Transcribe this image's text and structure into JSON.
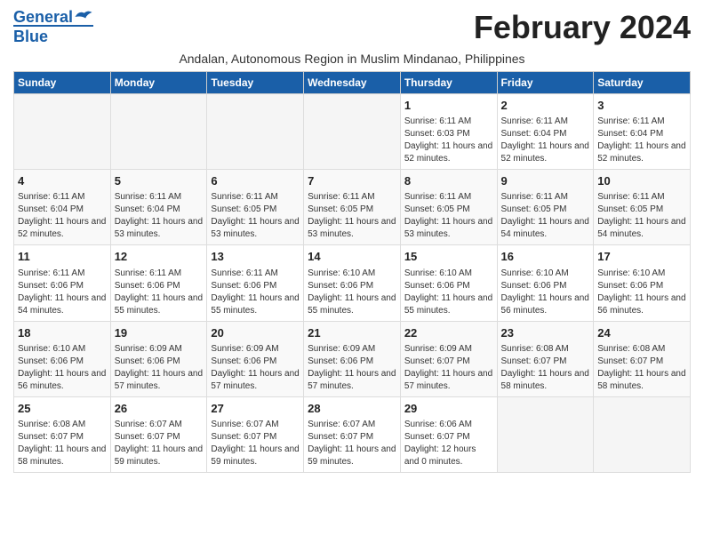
{
  "header": {
    "logo_line1": "General",
    "logo_line2": "Blue",
    "title": "February 2024",
    "subtitle": "Andalan, Autonomous Region in Muslim Mindanao, Philippines"
  },
  "weekdays": [
    "Sunday",
    "Monday",
    "Tuesday",
    "Wednesday",
    "Thursday",
    "Friday",
    "Saturday"
  ],
  "weeks": [
    [
      {
        "day": "",
        "info": ""
      },
      {
        "day": "",
        "info": ""
      },
      {
        "day": "",
        "info": ""
      },
      {
        "day": "",
        "info": ""
      },
      {
        "day": "1",
        "info": "Sunrise: 6:11 AM\nSunset: 6:03 PM\nDaylight: 11 hours and 52 minutes."
      },
      {
        "day": "2",
        "info": "Sunrise: 6:11 AM\nSunset: 6:04 PM\nDaylight: 11 hours and 52 minutes."
      },
      {
        "day": "3",
        "info": "Sunrise: 6:11 AM\nSunset: 6:04 PM\nDaylight: 11 hours and 52 minutes."
      }
    ],
    [
      {
        "day": "4",
        "info": "Sunrise: 6:11 AM\nSunset: 6:04 PM\nDaylight: 11 hours and 52 minutes."
      },
      {
        "day": "5",
        "info": "Sunrise: 6:11 AM\nSunset: 6:04 PM\nDaylight: 11 hours and 53 minutes."
      },
      {
        "day": "6",
        "info": "Sunrise: 6:11 AM\nSunset: 6:05 PM\nDaylight: 11 hours and 53 minutes."
      },
      {
        "day": "7",
        "info": "Sunrise: 6:11 AM\nSunset: 6:05 PM\nDaylight: 11 hours and 53 minutes."
      },
      {
        "day": "8",
        "info": "Sunrise: 6:11 AM\nSunset: 6:05 PM\nDaylight: 11 hours and 53 minutes."
      },
      {
        "day": "9",
        "info": "Sunrise: 6:11 AM\nSunset: 6:05 PM\nDaylight: 11 hours and 54 minutes."
      },
      {
        "day": "10",
        "info": "Sunrise: 6:11 AM\nSunset: 6:05 PM\nDaylight: 11 hours and 54 minutes."
      }
    ],
    [
      {
        "day": "11",
        "info": "Sunrise: 6:11 AM\nSunset: 6:06 PM\nDaylight: 11 hours and 54 minutes."
      },
      {
        "day": "12",
        "info": "Sunrise: 6:11 AM\nSunset: 6:06 PM\nDaylight: 11 hours and 55 minutes."
      },
      {
        "day": "13",
        "info": "Sunrise: 6:11 AM\nSunset: 6:06 PM\nDaylight: 11 hours and 55 minutes."
      },
      {
        "day": "14",
        "info": "Sunrise: 6:10 AM\nSunset: 6:06 PM\nDaylight: 11 hours and 55 minutes."
      },
      {
        "day": "15",
        "info": "Sunrise: 6:10 AM\nSunset: 6:06 PM\nDaylight: 11 hours and 55 minutes."
      },
      {
        "day": "16",
        "info": "Sunrise: 6:10 AM\nSunset: 6:06 PM\nDaylight: 11 hours and 56 minutes."
      },
      {
        "day": "17",
        "info": "Sunrise: 6:10 AM\nSunset: 6:06 PM\nDaylight: 11 hours and 56 minutes."
      }
    ],
    [
      {
        "day": "18",
        "info": "Sunrise: 6:10 AM\nSunset: 6:06 PM\nDaylight: 11 hours and 56 minutes."
      },
      {
        "day": "19",
        "info": "Sunrise: 6:09 AM\nSunset: 6:06 PM\nDaylight: 11 hours and 57 minutes."
      },
      {
        "day": "20",
        "info": "Sunrise: 6:09 AM\nSunset: 6:06 PM\nDaylight: 11 hours and 57 minutes."
      },
      {
        "day": "21",
        "info": "Sunrise: 6:09 AM\nSunset: 6:06 PM\nDaylight: 11 hours and 57 minutes."
      },
      {
        "day": "22",
        "info": "Sunrise: 6:09 AM\nSunset: 6:07 PM\nDaylight: 11 hours and 57 minutes."
      },
      {
        "day": "23",
        "info": "Sunrise: 6:08 AM\nSunset: 6:07 PM\nDaylight: 11 hours and 58 minutes."
      },
      {
        "day": "24",
        "info": "Sunrise: 6:08 AM\nSunset: 6:07 PM\nDaylight: 11 hours and 58 minutes."
      }
    ],
    [
      {
        "day": "25",
        "info": "Sunrise: 6:08 AM\nSunset: 6:07 PM\nDaylight: 11 hours and 58 minutes."
      },
      {
        "day": "26",
        "info": "Sunrise: 6:07 AM\nSunset: 6:07 PM\nDaylight: 11 hours and 59 minutes."
      },
      {
        "day": "27",
        "info": "Sunrise: 6:07 AM\nSunset: 6:07 PM\nDaylight: 11 hours and 59 minutes."
      },
      {
        "day": "28",
        "info": "Sunrise: 6:07 AM\nSunset: 6:07 PM\nDaylight: 11 hours and 59 minutes."
      },
      {
        "day": "29",
        "info": "Sunrise: 6:06 AM\nSunset: 6:07 PM\nDaylight: 12 hours and 0 minutes."
      },
      {
        "day": "",
        "info": ""
      },
      {
        "day": "",
        "info": ""
      }
    ]
  ]
}
